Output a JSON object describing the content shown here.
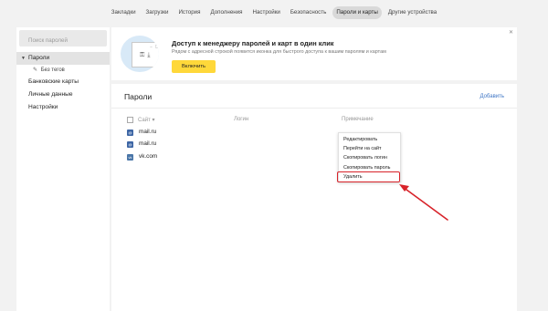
{
  "topnav": {
    "tabs": [
      "Закладки",
      "Загрузки",
      "История",
      "Дополнения",
      "Настройки",
      "Безопасность",
      "Пароли и карты",
      "Другие устройства"
    ],
    "active_index": 6
  },
  "sidebar": {
    "search_placeholder": "Поиск паролей",
    "items": [
      {
        "label": "Пароли",
        "active": true
      },
      {
        "label": "Без тегов",
        "sub": true
      },
      {
        "label": "Банковские карты"
      },
      {
        "label": "Личные данные"
      },
      {
        "label": "Настройки"
      }
    ]
  },
  "promo": {
    "title": "Доступ к менеджеру паролей и карт в один клик",
    "description": "Рядом с адресной строкой появится иконка для быстрого доступа к вашим паролям и картам",
    "button_label": "Включить",
    "close_icon": "close-icon",
    "accent_color": "#ffd83a"
  },
  "main": {
    "title": "Пароли",
    "add_link": "Добавить",
    "columns": {
      "site": "Сайт",
      "login": "Логин",
      "note": "Примечание"
    },
    "rows": [
      {
        "site": "mail.ru",
        "icon": "mailru-favicon"
      },
      {
        "site": "mail.ru",
        "icon": "mailru-favicon"
      },
      {
        "site": "vk.com",
        "icon": "vk-favicon"
      }
    ]
  },
  "context_menu": {
    "items": [
      "Редактировать",
      "Перейти на сайт",
      "Скопировать логин",
      "Скопировать пароль",
      "Удалить"
    ],
    "highlighted_index": 4,
    "highlight_color": "#d8232a"
  }
}
